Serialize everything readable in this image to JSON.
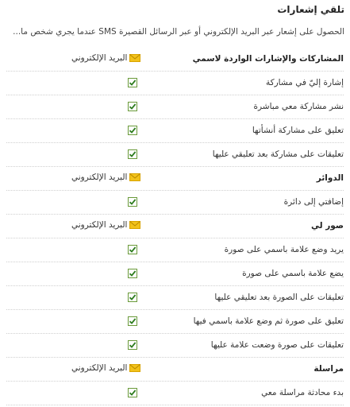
{
  "title": "تلقي إشعارات",
  "description": "الحصول على إشعار عبر البريد الإلكتروني أو عبر الرسائل القصيرة SMS عندما يجري شخص ما...",
  "email_label": "البريد الإلكتروني",
  "sections": [
    {
      "header": "المشاركات والإشارات الواردة لاسمي",
      "items": [
        {
          "label": "إشارة إليّ في مشاركة",
          "checked": true
        },
        {
          "label": "نشر مشاركة معي مباشرة",
          "checked": true
        },
        {
          "label": "تعليق على مشاركة أنشأتها",
          "checked": true
        },
        {
          "label": "تعليقات على مشاركة بعد تعليقي عليها",
          "checked": true
        }
      ]
    },
    {
      "header": "الدوائر",
      "items": [
        {
          "label": "إضافتي إلى دائرة",
          "checked": true
        }
      ]
    },
    {
      "header": "صور لي",
      "items": [
        {
          "label": "يريد وضع علامة باسمي على صورة",
          "checked": true
        },
        {
          "label": "يضع علامة باسمي على صورة",
          "checked": true
        },
        {
          "label": "تعليقات على الصورة بعد تعليقي عليها",
          "checked": true
        },
        {
          "label": "تعليق على صورة ثم وضع علامة باسمي فيها",
          "checked": true
        },
        {
          "label": "تعليقات على صورة وضعت علامة عليها",
          "checked": true
        }
      ]
    },
    {
      "header": "مراسلة",
      "items": [
        {
          "label": "بدء محادثة مراسلة معي",
          "checked": true
        }
      ]
    }
  ],
  "colors": {
    "checkbox_border": "#6a9a3a",
    "checkmark": "#2e7d1f",
    "envelope": "#f2c21b"
  },
  "icons": {
    "envelope": "envelope-icon",
    "check": "checkbox-checked-icon"
  }
}
